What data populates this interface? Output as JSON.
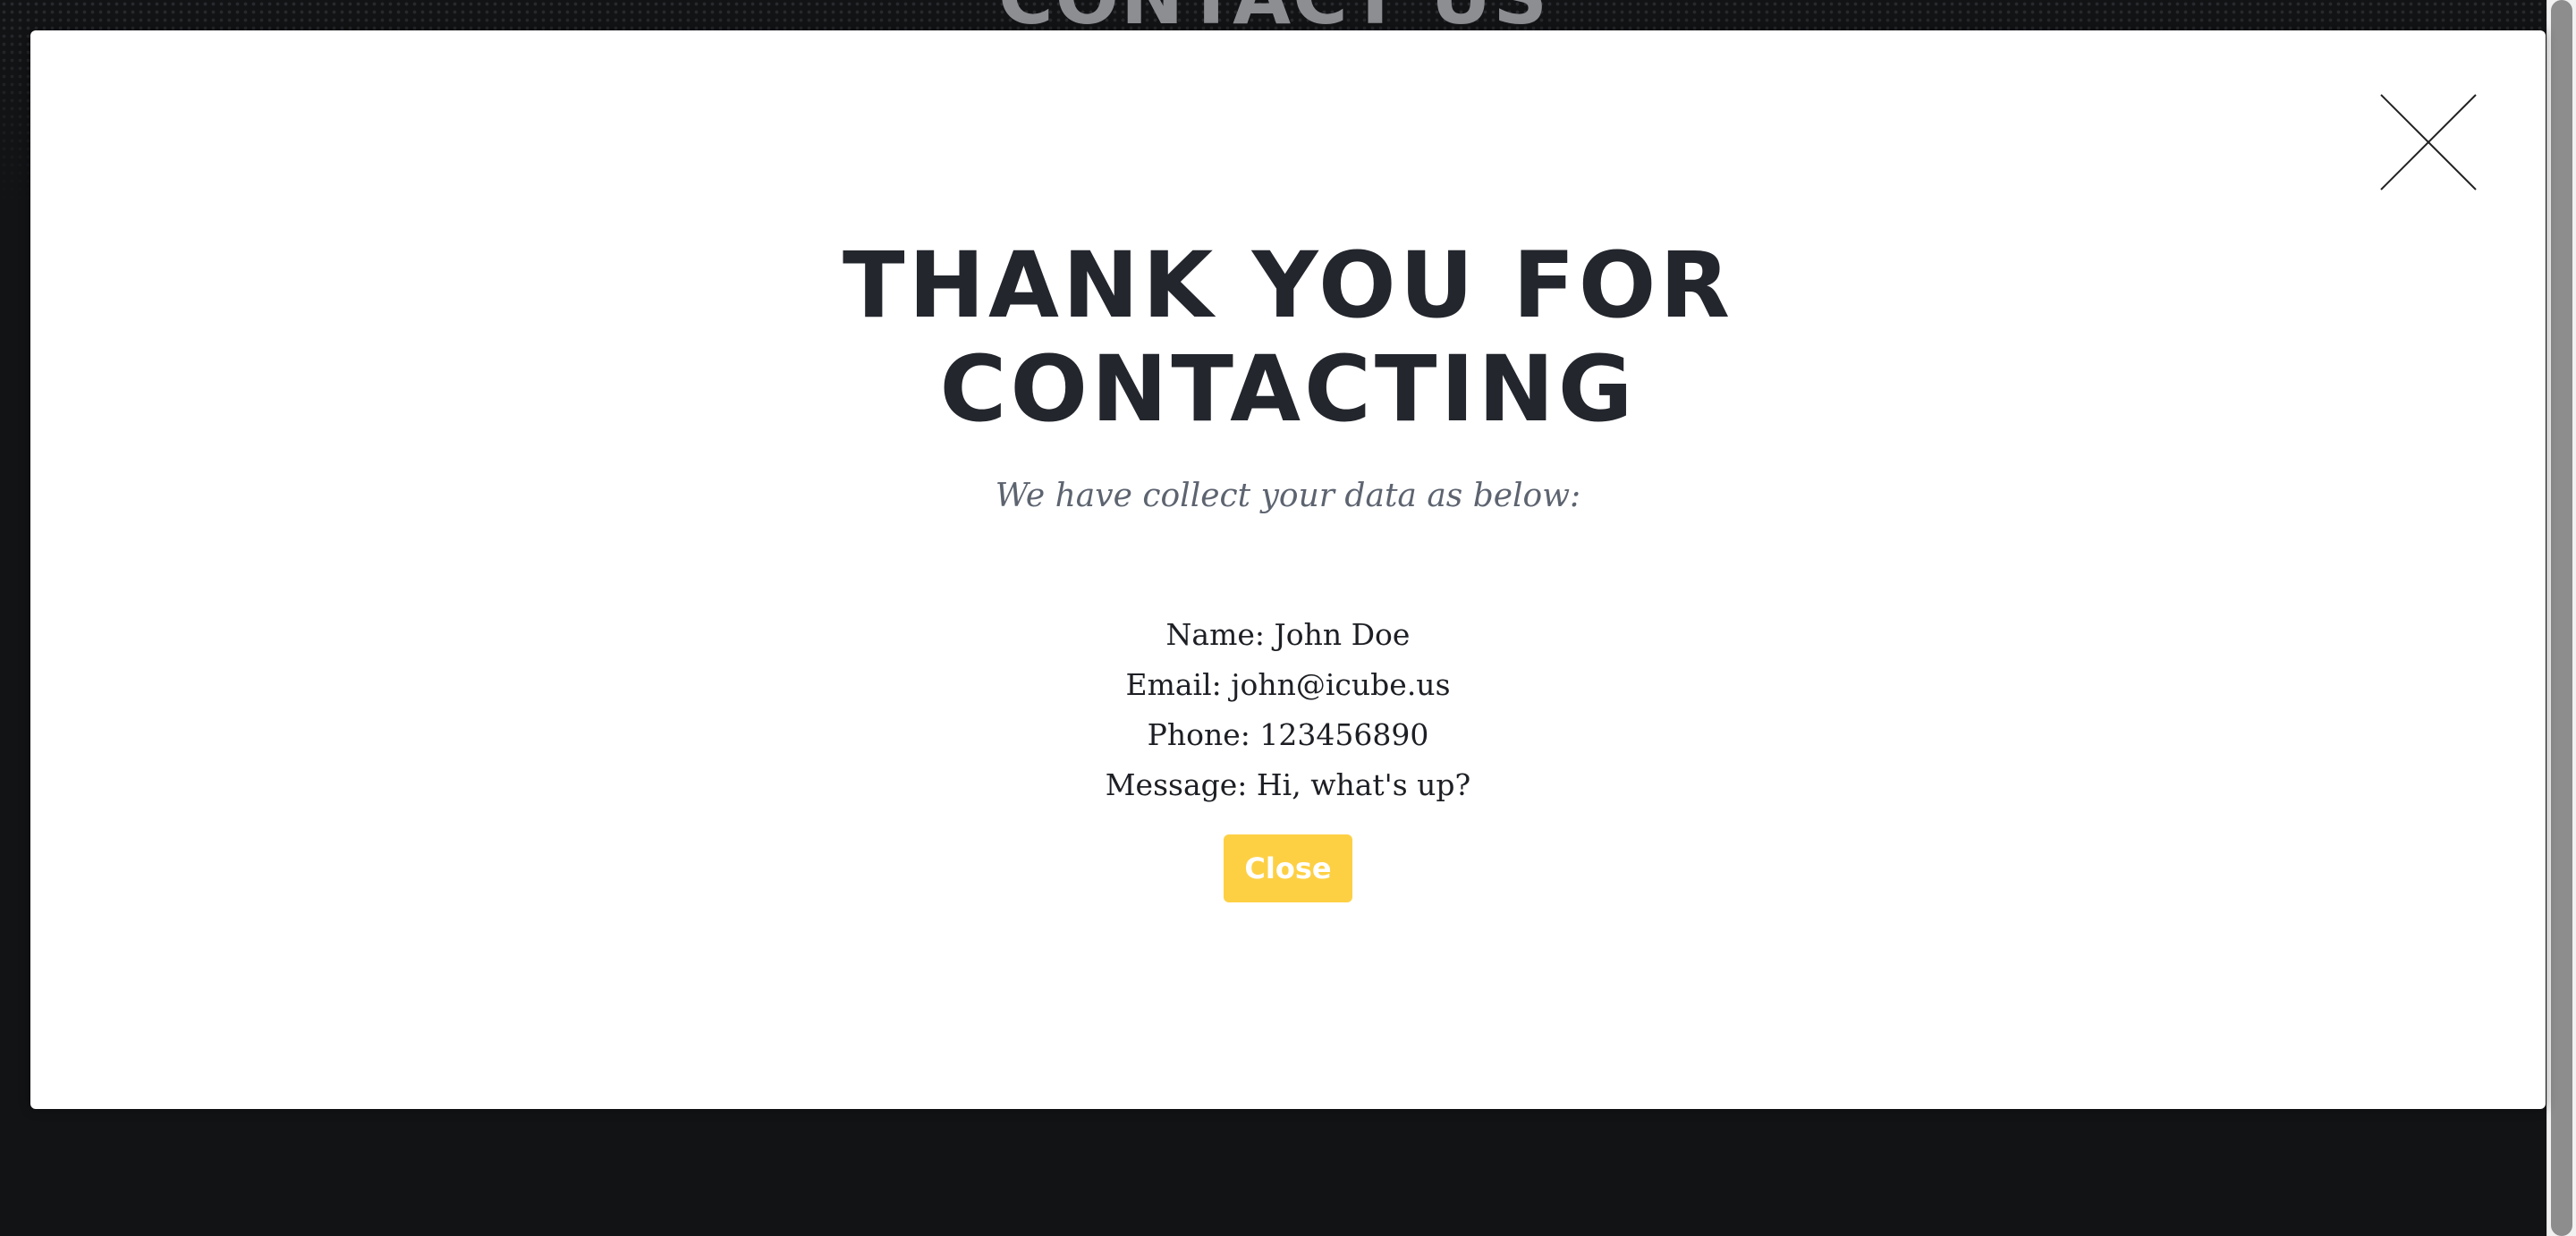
{
  "background": {
    "title": "CONTACT US"
  },
  "modal": {
    "title_line1": "THANK YOU FOR",
    "title_line2": "CONTACTING",
    "subtitle": "We have collect your data as below:",
    "fields": {
      "name": "Name: John Doe",
      "email": "Email: john@icube.us",
      "phone": "Phone: 123456890",
      "message": "Message: Hi, what's up?"
    },
    "close_button_label": "Close",
    "close_icon": "close-icon"
  },
  "colors": {
    "accent": "#fdd044",
    "title": "#23262d",
    "subtitle": "#5d6470",
    "page_background": "#111214"
  }
}
